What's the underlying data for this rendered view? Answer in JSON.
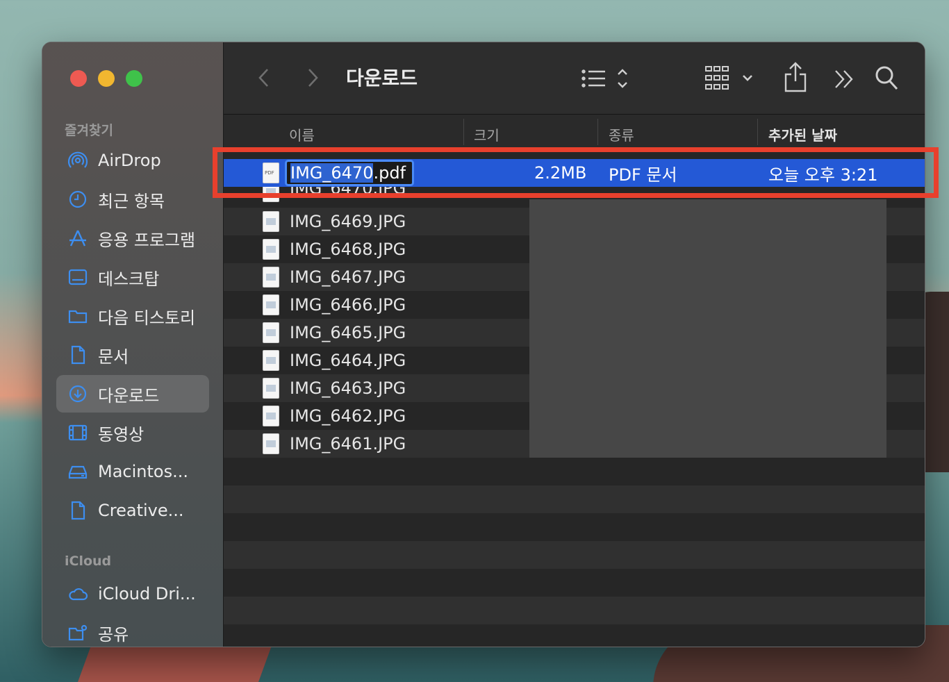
{
  "window": {
    "title": "다운로드"
  },
  "sidebar": {
    "favorites_header": "즐겨찾기",
    "icloud_header": "iCloud",
    "items": [
      {
        "label": "AirDrop",
        "icon": "airdrop-icon"
      },
      {
        "label": "최근 항목",
        "icon": "clock-icon"
      },
      {
        "label": "응용 프로그램",
        "icon": "applications-icon"
      },
      {
        "label": "데스크탑",
        "icon": "desktop-icon"
      },
      {
        "label": "다음 티스토리",
        "icon": "folder-icon"
      },
      {
        "label": "문서",
        "icon": "document-icon"
      },
      {
        "label": "다운로드",
        "icon": "download-icon",
        "active": true
      },
      {
        "label": "동영상",
        "icon": "film-icon"
      },
      {
        "label": "Macintos...",
        "icon": "disk-icon"
      },
      {
        "label": "Creative...",
        "icon": "file-icon"
      }
    ],
    "icloud_items": [
      {
        "label": "iCloud Dri...",
        "icon": "cloud-icon"
      },
      {
        "label": "공유",
        "icon": "shared-folder-icon"
      }
    ]
  },
  "columns": {
    "name": "이름",
    "size": "크기",
    "kind": "종류",
    "date_added": "추가된 날짜"
  },
  "selected_file": {
    "name_selected_part": "IMG_6470",
    "name_extension": ".pdf",
    "size": "2.2MB",
    "kind": "PDF 문서",
    "date_added": "오늘 오후 3:21"
  },
  "files": [
    {
      "name": "IMG_6470.JPG"
    },
    {
      "name": "IMG_6469.JPG"
    },
    {
      "name": "IMG_6468.JPG"
    },
    {
      "name": "IMG_6467.JPG"
    },
    {
      "name": "IMG_6466.JPG"
    },
    {
      "name": "IMG_6465.JPG"
    },
    {
      "name": "IMG_6464.JPG"
    },
    {
      "name": "IMG_6463.JPG"
    },
    {
      "name": "IMG_6462.JPG"
    },
    {
      "name": "IMG_6461.JPG"
    }
  ],
  "colors": {
    "selection": "#2459d6",
    "accent": "#3d8ef0",
    "highlight_outline": "#e8402d"
  }
}
